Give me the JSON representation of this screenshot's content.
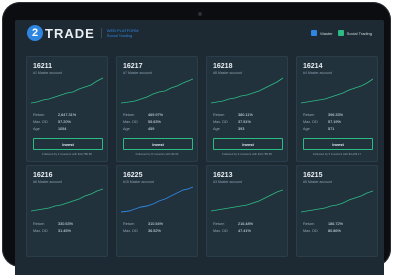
{
  "app": {
    "logo_mark": "2",
    "logo_text": "TRADE",
    "logo_sub_line1": "WEB PLATFORM",
    "logo_sub_line2": "Social Trading"
  },
  "filters": [
    {
      "label": "Master",
      "color": "#2f86e0"
    },
    {
      "label": "Social Trading",
      "color": "#2dbb84"
    }
  ],
  "invest_label": "Invest",
  "row1": [
    {
      "id": "16211",
      "sub": "#1 Master account",
      "return": "2,647.31%",
      "maxdd": "57.20%",
      "age": "1054",
      "follow": "Followed by 3 investors with $13,786.58"
    },
    {
      "id": "16217",
      "sub": "#7 Master account",
      "return": "469.97%",
      "maxdd": "55.63%",
      "age": "459",
      "follow": "Followed by 8 investors with $0.00"
    },
    {
      "id": "16218",
      "sub": "#8 Master account",
      "return": "380.11%",
      "maxdd": "37.51%",
      "age": "393",
      "follow": "Followed by 9 investors with $13,785.58"
    },
    {
      "id": "16214",
      "sub": "#4 Master account",
      "return": "396.33%",
      "maxdd": "57.19%",
      "age": "571",
      "follow": "Followed by 5 investors with $3,409.17"
    }
  ],
  "row2": [
    {
      "id": "16216",
      "sub": "#6 Master account",
      "return": "330.53%",
      "maxdd": "31.45%"
    },
    {
      "id": "16225",
      "sub": "#15 Master account",
      "return": "310.54%",
      "maxdd": "36.52%"
    },
    {
      "id": "16213",
      "sub": "#3 Master account",
      "return": "216.48%",
      "maxdd": "47.41%"
    },
    {
      "id": "16215",
      "sub": "#5 Master account",
      "return": "186.72%",
      "maxdd": "80.86%"
    }
  ],
  "labels": {
    "return": "Return",
    "maxdd": "Max. DD",
    "age": "Age"
  }
}
